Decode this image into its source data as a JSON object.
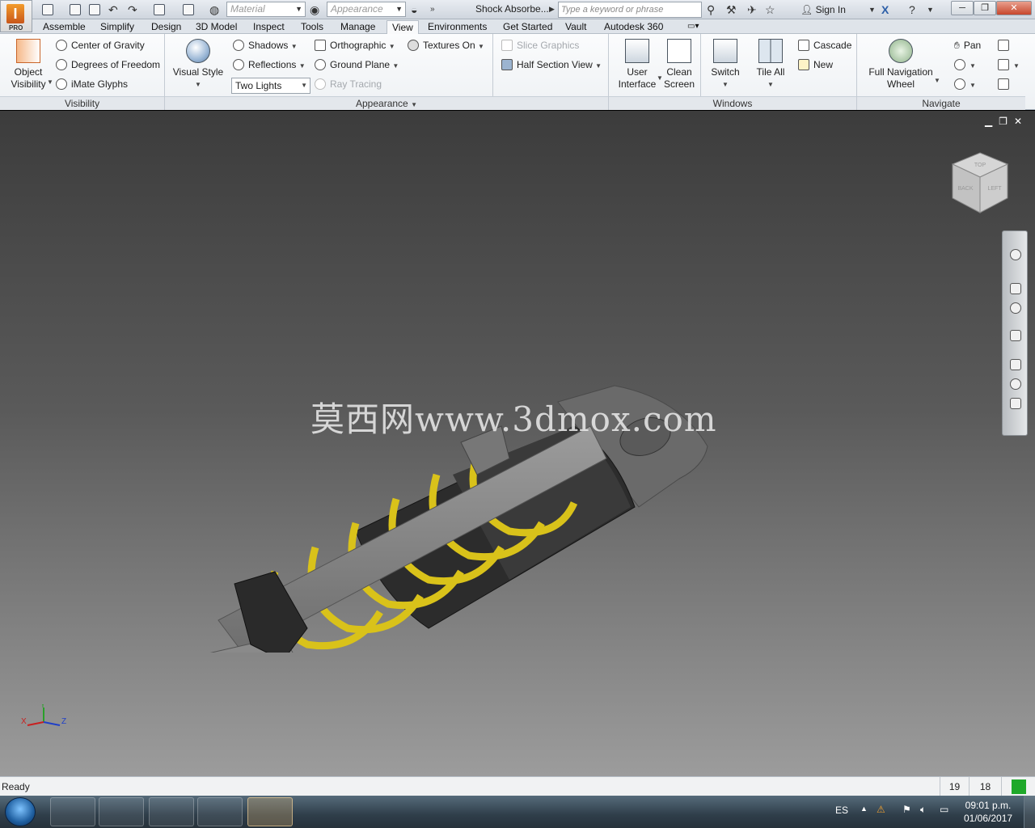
{
  "app": {
    "title": "Shock Absorbe...",
    "logo_letter": "I",
    "edition": "PRO"
  },
  "qat": {
    "material_placeholder": "Material",
    "appearance_placeholder": "Appearance",
    "search_placeholder": "Type a keyword or phrase",
    "sign_in": "Sign In"
  },
  "tabs": [
    "Assemble",
    "Simplify",
    "Design",
    "3D Model",
    "Inspect",
    "Tools",
    "Manage",
    "View",
    "Environments",
    "Get Started",
    "Vault",
    "Autodesk 360"
  ],
  "active_tab": "View",
  "ribbon": {
    "visibility": {
      "label": "Visibility",
      "object_visibility": "Object\nVisibility",
      "object_visibility_l1": "Object",
      "object_visibility_l2": "Visibility",
      "center_of_gravity": "Center of Gravity",
      "degrees_of_freedom": "Degrees of Freedom",
      "imate_glyphs": "iMate Glyphs"
    },
    "appearance": {
      "label": "Appearance",
      "visual_style": "Visual Style",
      "shadows": "Shadows",
      "reflections": "Reflections",
      "lighting": "Two Lights",
      "orthographic": "Orthographic",
      "ground_plane": "Ground Plane",
      "ray_tracing": "Ray Tracing",
      "textures": "Textures On",
      "slice_graphics": "Slice Graphics",
      "half_section_view": "Half Section View"
    },
    "windows": {
      "label": "Windows",
      "user_interface_l1": "User",
      "user_interface_l2": "Interface",
      "clean_screen_l1": "Clean",
      "clean_screen_l2": "Screen",
      "switch": "Switch",
      "tile_all": "Tile All",
      "cascade": "Cascade",
      "new": "New"
    },
    "navigate": {
      "label": "Navigate",
      "full_nav_l1": "Full Navigation",
      "full_nav_l2": "Wheel",
      "pan": "Pan"
    }
  },
  "viewport": {
    "watermark": "莫西网www.3dmox.com",
    "viewcube_faces": [
      "TOP",
      "BACK",
      "LEFT"
    ],
    "triad_axes": [
      "X",
      "Y",
      "Z"
    ]
  },
  "status": {
    "text": "Ready",
    "count_a": "19",
    "count_b": "18",
    "indicator_color": "#1fa82a"
  },
  "taskbar": {
    "language": "ES",
    "time": "09:01 p.m.",
    "date": "01/06/2017"
  },
  "colors": {
    "accent": "#d9641e",
    "spring": "#d9c21a",
    "metal": "#8a8a8a"
  }
}
